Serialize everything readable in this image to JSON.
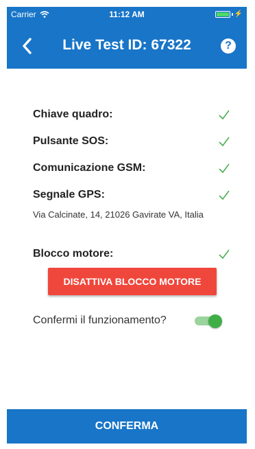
{
  "status_bar": {
    "carrier": "Carrier",
    "time": "11:12 AM",
    "wifi_icon": "wifi-icon",
    "battery_icon": "battery-icon",
    "charging_icon": "bolt-icon"
  },
  "navbar": {
    "title": "Live Test ID: 67322",
    "back_icon": "chevron-left-icon",
    "help_icon": "question-circle-icon",
    "help_glyph": "?"
  },
  "checks": [
    {
      "label": "Chiave quadro:",
      "status_icon": "check-icon"
    },
    {
      "label": "Pulsante SOS:",
      "status_icon": "check-icon"
    },
    {
      "label": "Comunicazione GSM:",
      "status_icon": "check-icon"
    },
    {
      "label": "Segnale GPS:",
      "status_icon": "check-icon"
    },
    {
      "label": "Blocco motore:",
      "status_icon": "check-icon"
    }
  ],
  "gps_address": "Via Calcinate, 14, 21026 Gavirate VA, Italia",
  "disable_engine_block_button": "DISATTIVA BLOCCO MOTORE",
  "confirm_toggle": {
    "label": "Confermi il funzionamento?",
    "on": true
  },
  "footer_button": "CONFERMA",
  "colors": {
    "primary": "#1875c8",
    "danger": "#f0473c",
    "check": "#4caf50",
    "toggle_on": "#3fae46"
  }
}
